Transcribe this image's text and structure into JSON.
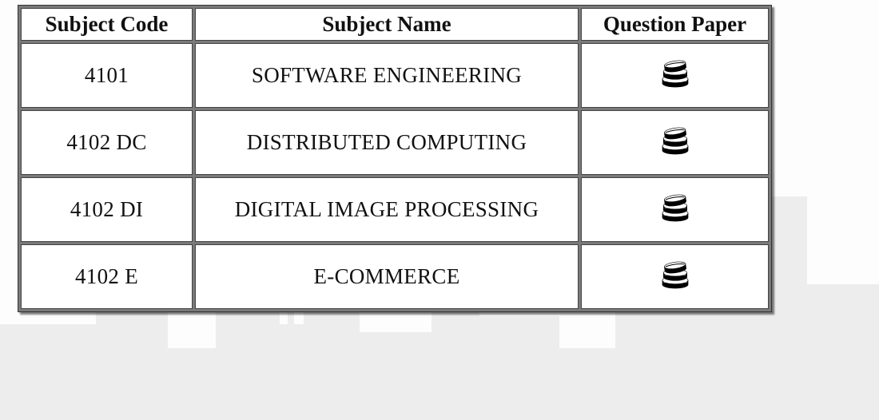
{
  "table": {
    "headers": {
      "code": "Subject Code",
      "name": "Subject Name",
      "paper": "Question Paper"
    },
    "rows": [
      {
        "code": "4101",
        "name": "SOFTWARE ENGINEERING",
        "paper_icon": "books-icon"
      },
      {
        "code": "4102 DC",
        "name": "DISTRIBUTED COMPUTING",
        "paper_icon": "books-icon"
      },
      {
        "code": "4102 DI",
        "name": "DIGITAL IMAGE PROCESSING",
        "paper_icon": "books-icon"
      },
      {
        "code": "4102 E",
        "name": "E-COMMERCE",
        "paper_icon": "books-icon"
      }
    ]
  }
}
